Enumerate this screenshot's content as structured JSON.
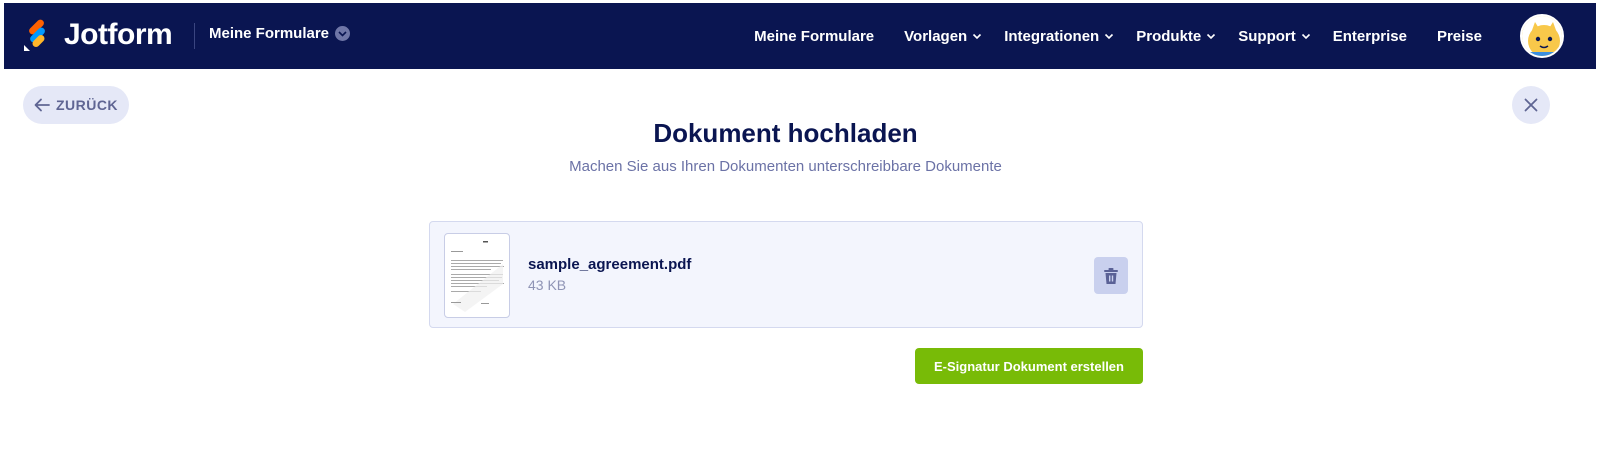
{
  "header": {
    "brand": "Jotform",
    "my_forms_dropdown": "Meine Formulare",
    "nav": {
      "my_forms": "Meine Formulare",
      "templates": "Vorlagen",
      "integrations": "Integrationen",
      "products": "Produkte",
      "support": "Support",
      "enterprise": "Enterprise",
      "pricing": "Preise"
    }
  },
  "page": {
    "back_label": "ZURÜCK",
    "title": "Dokument hochladen",
    "subtitle": "Machen Sie aus Ihren Dokumenten unterschreibbare Dokumente"
  },
  "file": {
    "name": "sample_agreement.pdf",
    "size": "43 KB"
  },
  "actions": {
    "create_label": "E-Signatur Dokument erstellen"
  },
  "colors": {
    "navbar": "#0a1551",
    "accent_green": "#78bb07",
    "soft_button": "#e5e8f7"
  },
  "icons": {
    "back": "arrow-left-icon",
    "close": "close-icon",
    "delete": "trash-icon",
    "chevron": "chevron-down-icon"
  }
}
